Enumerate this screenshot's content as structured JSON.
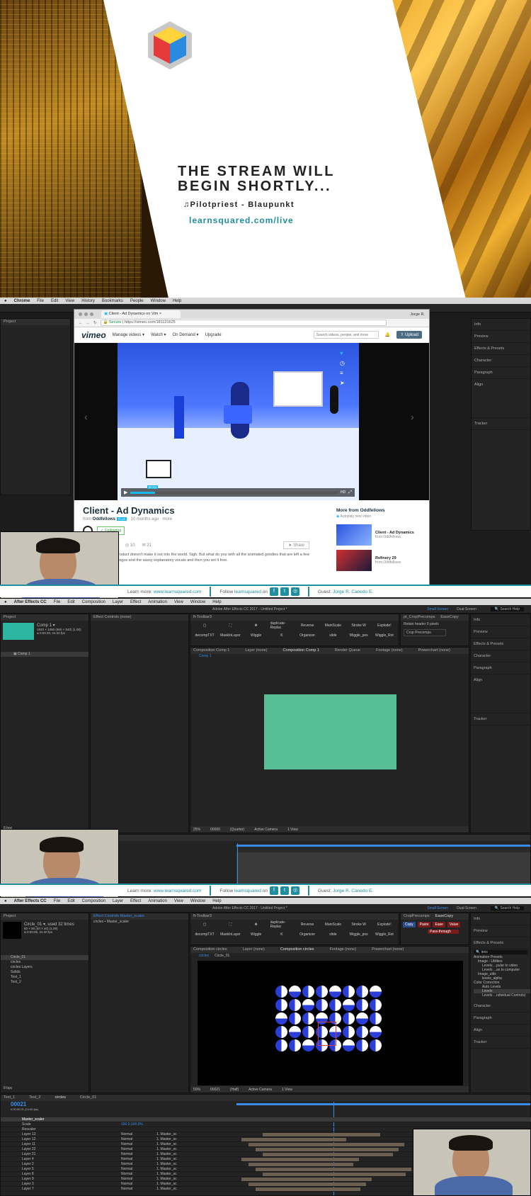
{
  "title_card": {
    "headline_line1": "THE STREAM WILL",
    "headline_line2": "BEGIN SHORTLY...",
    "now_playing": "♫Pilotpriest - Blaupunkt",
    "url": "learnsquared.com/live"
  },
  "chrome": {
    "menu": [
      "Chrome",
      "File",
      "Edit",
      "View",
      "History",
      "Bookmarks",
      "People",
      "Window",
      "Help"
    ],
    "tab_label": "Client - Ad Dynamics on Vim",
    "address_secure": "Secure",
    "address_url": "https://vimeo.com/181121625",
    "profile": "Jorge R."
  },
  "vimeo": {
    "logo": "vimeo",
    "nav": [
      "Manage videos ▾",
      "Watch ▾",
      "On Demand ▾",
      "Upgrade"
    ],
    "search_placeholder": "Search videos, people, and more",
    "upload_label": "Upload",
    "video_title": "Client - Ad Dynamics",
    "from_label": "from",
    "author": "Oddfellows",
    "badge": "PLUS",
    "age": "10 months ago",
    "more": "more",
    "following": "✓ Following",
    "likes": "10",
    "comments": "21",
    "share": "Share",
    "description": "roduct doesn't make it out into the world. Sigh. But what do you with all the animated goodies that are left a few logos and the sassy explanatory vocals and then you set it free.",
    "sidebar_title": "More from Oddfellows",
    "autoplay": "Autoplay next video",
    "related": [
      {
        "title": "Client - Ad Dynamics",
        "author": "from Oddfellows"
      },
      {
        "title": "Refinery 29",
        "author": "from Oddfellows"
      }
    ],
    "timecode": "00:24"
  },
  "banner": {
    "learn_label": "Learn more:",
    "learn_url": "www.learnsquared.com",
    "follow_label": "Follow",
    "follow_handle": "learnsquared",
    "follow_on": "on",
    "guest_label": "Guest:",
    "guest_name": "Jorge R. Canedo E."
  },
  "ae_menu": [
    "After Effects CC",
    "File",
    "Edit",
    "Composition",
    "Layer",
    "Effect",
    "Animation",
    "View",
    "Window",
    "Help"
  ],
  "ae_title": "Adobe After Effects CC 2017 - Untitled Project *",
  "ae_right_panels": [
    "Info",
    "Preview",
    "Effects & Presets",
    "Character",
    "Paragraph",
    "Align",
    "Tracker"
  ],
  "ae_workspace": [
    "Small Screen",
    "Dual-Screen"
  ],
  "ae_search": "Search Help",
  "ft_toolbar": "ft-Toolbar3",
  "ft_buttons": [
    "decompTXT",
    "MaskInLayer",
    "Wiggle",
    "K",
    "Organizer",
    "slide",
    "Wiggle_pos",
    "Wiggle_Rot",
    "pT12Zer",
    "pT6",
    "pT12",
    "LoopPath",
    "LoopOut",
    "LoopCont.",
    "Duplicator",
    "Layer"
  ],
  "ft_top": [
    "duplicate-Replac",
    "Reverse",
    "MainScale",
    "Stroke W",
    "Explode!",
    "Last"
  ],
  "panel2": {
    "project": "Project",
    "comp_name": "Comp 1 ▾",
    "comp_info": "1920 × 1080 (960 × 540) (1.00)\nΔ 0:00:20, 24.00 fps",
    "effect_controls": "Effect Controls (none)",
    "composition_tab": "Composition Comp 1",
    "layer_tab": "Layer (none)",
    "render_tab": "Render Queue",
    "footage_tab": "Footage (none)",
    "powerchart": "Powerchart (none)",
    "comp_breadcrumb": "Comp 1",
    "zoom": "25%",
    "timecode": "00000",
    "quality": "(Quarter)",
    "camera": "Active Camera",
    "view": "1 View",
    "layer_name": "Comp 1",
    "timeline_tab": "Comp 1",
    "bpc": "8 bpc",
    "precomp_panel": "pt_CropPrecomps",
    "retain_header": "Retain header",
    "pixels_label": "pixels",
    "crop_btn": "Crop Precomps",
    "ease_copy": "EaseCopy",
    "shape_color": "#57be96"
  },
  "panel3": {
    "project_item": "Circle_01 ▾, used 32 times",
    "project_info": "80 × 80 (40 × 40) (1.00)\nΔ 0:00:05, 24.00 fps",
    "tree": [
      "Circle_01",
      "circles",
      "circles Layers",
      "Solids",
      "Text_1",
      "Text_2"
    ],
    "effect_controls": "Effect Controls Master_scaler",
    "ec_sub": "circles • Master_scaler",
    "comp_tab": "Composition circles",
    "breadcrumb": [
      "circles",
      "Circle_01"
    ],
    "zoom": "50%",
    "timecode": "00021",
    "quality": "(Half)",
    "camera": "Active Camera",
    "view": "1 View",
    "tl_tabs": [
      "Text_1",
      "Text_2",
      "circles",
      "Circle_01"
    ],
    "tl_time": "00021",
    "tl_sub": "0:00:00:21 (24.00 fps)",
    "layers": [
      "Master_scaler",
      "Scale",
      "Rescaler",
      "Layer 13",
      "Layer 12",
      "Layer 11",
      "Layer 22",
      "Layer 21",
      "Layer 4",
      "Layer 2",
      "Layer 5",
      "Layer 8",
      "Layer 9",
      "Layer 3",
      "Layer 7"
    ],
    "mode": "Normal",
    "parent": "1. Master_sc",
    "scale_val": "100.0,100.0%",
    "ease_copy": "EaseCopy",
    "copy": "Copy",
    "paste": "Paste",
    "ease": "Ease",
    "value": "Value",
    "pass_through": "Pass-through",
    "crop_tab": "CropPrecomps",
    "search_term": "lens",
    "effects_tree": [
      "Animation Presets",
      "Image - Utilities",
      "Levels ...pular to video",
      "Levels ...ax to computer",
      "Image_utils",
      "levels_alpha",
      "Color Correction",
      "Auto Levels",
      "Levels",
      "Levels ...ndividual Controls)"
    ],
    "bpc": "8 bpc"
  },
  "colors": {
    "teal": "#1f8ea0",
    "ae_bg": "#1c1c1c",
    "comp_shape": "#57be96",
    "dot_blue": "#2b3fd8",
    "timeline_blue": "#3a8ae8"
  }
}
